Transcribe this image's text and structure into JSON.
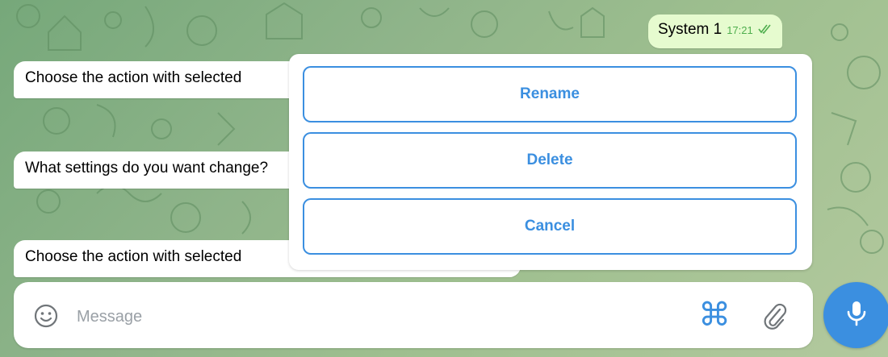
{
  "messages": {
    "outgoing": {
      "text": "System 1",
      "time": "17:21",
      "status": "read",
      "status_icon": "double-check-icon"
    },
    "incoming": [
      {
        "text": "Choose the action with selected"
      },
      {
        "text": "What settings do you want change?"
      },
      {
        "text": "Choose the action with selected"
      }
    ]
  },
  "inline_keyboard": {
    "buttons": [
      {
        "label": "Rename"
      },
      {
        "label": "Delete"
      },
      {
        "label": "Cancel"
      }
    ]
  },
  "composer": {
    "placeholder": "Message",
    "value": "",
    "emoji_icon": "emoji-icon",
    "commands_icon": "command-icon",
    "commands_glyph": "⌘",
    "attach_icon": "paperclip-icon",
    "mic_icon": "microphone-icon"
  },
  "colors": {
    "accent": "#3b8fe0",
    "outgoing_bubble": "#e6fbcf",
    "incoming_bubble": "#ffffff",
    "read_ticks": "#4fae4e",
    "wallpaper": "#8fb48a"
  }
}
